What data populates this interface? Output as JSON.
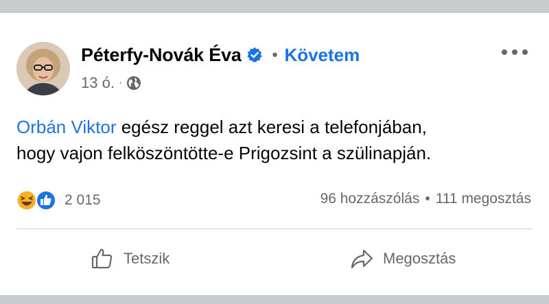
{
  "post": {
    "author": "Péterfy-Novák Éva",
    "separator": "•",
    "follow_label": "Követem",
    "time": "13 ó.",
    "meta_separator": "·",
    "text_mention": "Orbán Viktor",
    "text_body_line1": " egész reggel azt keresi a telefonjában,",
    "text_body_line2": "hogy vajon felköszöntötte-e Prigozsint a szülinapján."
  },
  "reactions": {
    "count": "2 015",
    "icons": [
      "haha-icon",
      "like-icon"
    ]
  },
  "stats": {
    "comments": "96 hozzászólás",
    "separator": "•",
    "shares": "111 megosztás"
  },
  "actions": {
    "like_label": "Tetszik",
    "share_label": "Megosztás"
  },
  "colors": {
    "accent": "#1b74e4",
    "text": "#050505",
    "muted": "#65676b",
    "band": "#c9ccd1"
  }
}
